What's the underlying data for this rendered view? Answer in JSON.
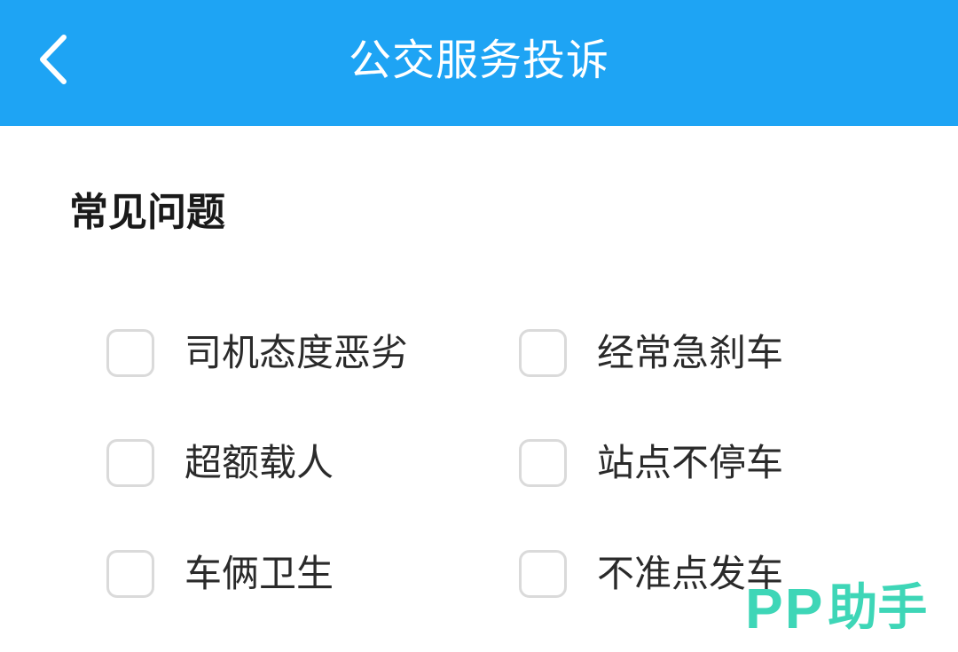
{
  "header": {
    "title": "公交服务投诉",
    "background_color": "#1ea4f4",
    "back_icon": "chevron-left-icon"
  },
  "section": {
    "title": "常见问题"
  },
  "options": [
    {
      "label": "司机态度恶劣",
      "checked": false
    },
    {
      "label": "经常急刹车",
      "checked": false
    },
    {
      "label": "超额载人",
      "checked": false
    },
    {
      "label": "站点不停车",
      "checked": false
    },
    {
      "label": "车俩卫生",
      "checked": false
    },
    {
      "label": "不准点发车",
      "checked": false
    }
  ],
  "watermark": {
    "latin": "PP",
    "cn": "助手",
    "color": "#3ed6b7"
  }
}
